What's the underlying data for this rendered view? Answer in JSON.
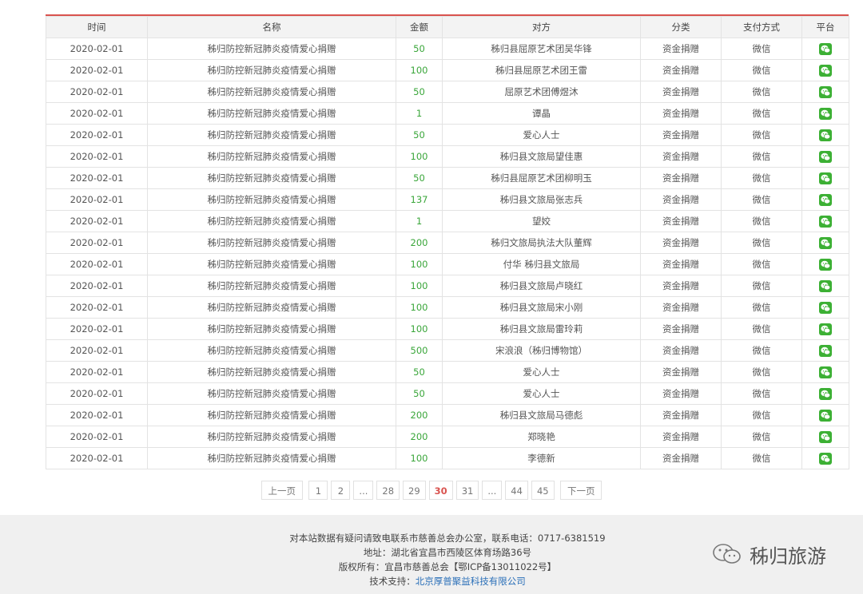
{
  "table": {
    "headers": [
      "时间",
      "名称",
      "金额",
      "对方",
      "分类",
      "支付方式",
      "平台"
    ],
    "rows": [
      {
        "time": "2020-02-01",
        "name": "秭归防控新冠肺炎疫情爱心捐赠",
        "amount": "50",
        "party": "秭归县屈原艺术团吴华锋",
        "category": "资金捐赠",
        "pay": "微信"
      },
      {
        "time": "2020-02-01",
        "name": "秭归防控新冠肺炎疫情爱心捐赠",
        "amount": "100",
        "party": "秭归县屈原艺术团王雷",
        "category": "资金捐赠",
        "pay": "微信"
      },
      {
        "time": "2020-02-01",
        "name": "秭归防控新冠肺炎疫情爱心捐赠",
        "amount": "50",
        "party": "屈原艺术团傅煜沐",
        "category": "资金捐赠",
        "pay": "微信"
      },
      {
        "time": "2020-02-01",
        "name": "秭归防控新冠肺炎疫情爱心捐赠",
        "amount": "1",
        "party": "谭晶",
        "category": "资金捐赠",
        "pay": "微信"
      },
      {
        "time": "2020-02-01",
        "name": "秭归防控新冠肺炎疫情爱心捐赠",
        "amount": "50",
        "party": "爱心人士",
        "category": "资金捐赠",
        "pay": "微信"
      },
      {
        "time": "2020-02-01",
        "name": "秭归防控新冠肺炎疫情爱心捐赠",
        "amount": "100",
        "party": "秭归县文旅局望佳惠",
        "category": "资金捐赠",
        "pay": "微信"
      },
      {
        "time": "2020-02-01",
        "name": "秭归防控新冠肺炎疫情爱心捐赠",
        "amount": "50",
        "party": "秭归县屈原艺术团柳明玉",
        "category": "资金捐赠",
        "pay": "微信"
      },
      {
        "time": "2020-02-01",
        "name": "秭归防控新冠肺炎疫情爱心捐赠",
        "amount": "137",
        "party": "秭归县文旅局张志兵",
        "category": "资金捐赠",
        "pay": "微信"
      },
      {
        "time": "2020-02-01",
        "name": "秭归防控新冠肺炎疫情爱心捐赠",
        "amount": "1",
        "party": "望姣",
        "category": "资金捐赠",
        "pay": "微信"
      },
      {
        "time": "2020-02-01",
        "name": "秭归防控新冠肺炎疫情爱心捐赠",
        "amount": "200",
        "party": "秭归文旅局执法大队董辉",
        "category": "资金捐赠",
        "pay": "微信"
      },
      {
        "time": "2020-02-01",
        "name": "秭归防控新冠肺炎疫情爱心捐赠",
        "amount": "100",
        "party": "付华 秭归县文旅局",
        "category": "资金捐赠",
        "pay": "微信"
      },
      {
        "time": "2020-02-01",
        "name": "秭归防控新冠肺炎疫情爱心捐赠",
        "amount": "100",
        "party": "秭归县文旅局卢晓红",
        "category": "资金捐赠",
        "pay": "微信"
      },
      {
        "time": "2020-02-01",
        "name": "秭归防控新冠肺炎疫情爱心捐赠",
        "amount": "100",
        "party": "秭归县文旅局宋小刚",
        "category": "资金捐赠",
        "pay": "微信"
      },
      {
        "time": "2020-02-01",
        "name": "秭归防控新冠肺炎疫情爱心捐赠",
        "amount": "100",
        "party": "秭归县文旅局雷玲莉",
        "category": "资金捐赠",
        "pay": "微信"
      },
      {
        "time": "2020-02-01",
        "name": "秭归防控新冠肺炎疫情爱心捐赠",
        "amount": "500",
        "party": "宋浪浪（秭归博物馆）",
        "category": "资金捐赠",
        "pay": "微信"
      },
      {
        "time": "2020-02-01",
        "name": "秭归防控新冠肺炎疫情爱心捐赠",
        "amount": "50",
        "party": "爱心人士",
        "category": "资金捐赠",
        "pay": "微信"
      },
      {
        "time": "2020-02-01",
        "name": "秭归防控新冠肺炎疫情爱心捐赠",
        "amount": "50",
        "party": "爱心人士",
        "category": "资金捐赠",
        "pay": "微信"
      },
      {
        "time": "2020-02-01",
        "name": "秭归防控新冠肺炎疫情爱心捐赠",
        "amount": "200",
        "party": "秭归县文旅局马德彪",
        "category": "资金捐赠",
        "pay": "微信"
      },
      {
        "time": "2020-02-01",
        "name": "秭归防控新冠肺炎疫情爱心捐赠",
        "amount": "200",
        "party": "郑晓艳",
        "category": "资金捐赠",
        "pay": "微信"
      },
      {
        "time": "2020-02-01",
        "name": "秭归防控新冠肺炎疫情爱心捐赠",
        "amount": "100",
        "party": "李德新",
        "category": "资金捐赠",
        "pay": "微信"
      }
    ],
    "platform_icon": "wechat-icon"
  },
  "pagination": {
    "prev": "上一页",
    "next": "下一页",
    "pages": [
      "1",
      "2",
      "...",
      "28",
      "29",
      "30",
      "31",
      "...",
      "44",
      "45"
    ],
    "current": "30"
  },
  "footer": {
    "line1": "对本站数据有疑问请致电联系市慈善总会办公室，联系电话：0717-6381519",
    "line2": "地址：湖北省宜昌市西陵区体育场路36号",
    "line3": "版权所有：宜昌市慈善总会【鄂ICP备13011022号】",
    "line4_prefix": "技术支持：",
    "line4_link": "北京厚普聚益科技有限公司",
    "brand": "秭归旅游"
  },
  "colors": {
    "accent": "#d9534f",
    "amount": "#3aa63a",
    "wechat": "#3cb034",
    "link": "#2a6fb8"
  }
}
